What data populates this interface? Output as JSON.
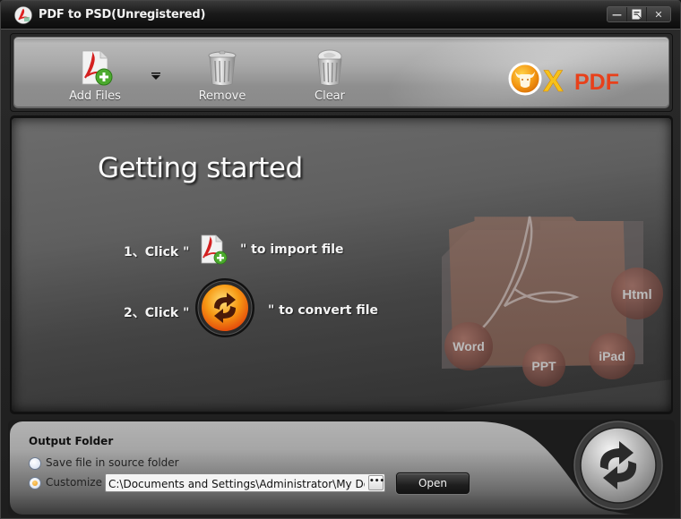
{
  "window": {
    "title": "PDF to PSD(Unregistered)",
    "controls": {
      "minimize_icon": "minimize-icon",
      "restore_icon": "restore-icon",
      "close_icon": "close-icon",
      "minimize_glyph": "—",
      "restore_glyph": "▣",
      "close_glyph": "✕"
    }
  },
  "toolbar": {
    "add_files_label": "Add Files",
    "remove_label": "Remove",
    "clear_label": "Clear",
    "add_files_icon": "pdf-add-icon",
    "dropdown_icon": "dropdown-arrow-icon",
    "remove_icon": "trash-can-icon",
    "clear_icon": "trash-can-full-icon",
    "logo_text_x": "X",
    "logo_text_pdf": "PDF"
  },
  "main": {
    "heading": "Getting started",
    "step1_prefix": "1、Click \"",
    "step1_suffix": "\" to import file",
    "step2_prefix": "2、Click \"",
    "step2_suffix": "\" to convert file",
    "art_labels": [
      "Word",
      "PPT",
      "iPad",
      "Html"
    ]
  },
  "output": {
    "label": "Output Folder",
    "option_source": "Save file in source folder",
    "option_customize": "Customize",
    "selected_option": "customize",
    "path_value": "C:\\Documents and Settings\\Administrator\\My Documents",
    "browse_label": "•••",
    "open_label": "Open"
  },
  "colors": {
    "accent_orange": "#f0a020",
    "logo_red": "#e8401a",
    "logo_yellow": "#f6c21a"
  }
}
